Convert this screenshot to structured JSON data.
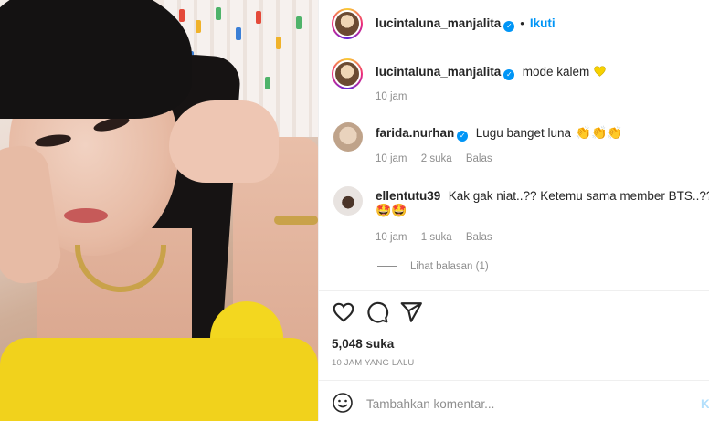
{
  "header": {
    "username": "lucintaluna_manjalita",
    "follow_label": "Ikuti"
  },
  "caption": {
    "username": "lucintaluna_manjalita",
    "text": "mode kalem",
    "emoji": "yellow-heart",
    "time": "10 jam"
  },
  "comments": [
    {
      "username": "farida.nurhan",
      "verified": true,
      "text": "Lugu banget luna",
      "emoji": "👏👏👏",
      "time": "10 jam",
      "likes": "2 suka",
      "reply": "Balas"
    },
    {
      "username": "ellentutu39",
      "verified": false,
      "text": "Kak gak niat..?? Ketemu sama member BTS..??",
      "emoji": "🤩",
      "emoji_line2": "🤩🤩",
      "time": "10 jam",
      "likes": "1 suka",
      "reply": "Balas",
      "view_replies": "Lihat balasan (1)"
    }
  ],
  "post": {
    "likes": "5,048 suka",
    "time_ago": "10 JAM YANG LALU"
  },
  "comment_input": {
    "placeholder": "Tambahkan komentar...",
    "post_label": "K"
  },
  "colors": {
    "accent": "#0095f6",
    "muted": "#8e8e8e"
  }
}
